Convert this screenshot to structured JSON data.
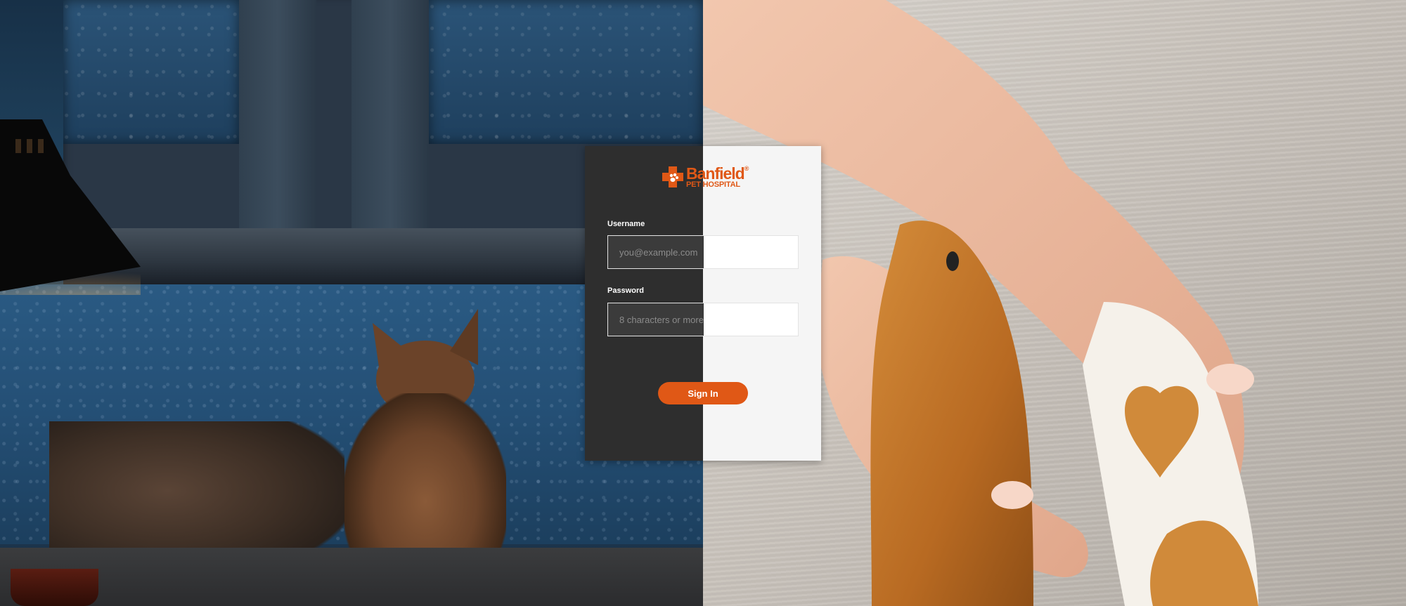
{
  "brand": {
    "name": "Banfield",
    "subtitle": "PET HOSPITAL",
    "trademark": "®",
    "color": "#e05816"
  },
  "login": {
    "username_label": "Username",
    "username_placeholder": "you@example.com",
    "username_value": "",
    "password_label": "Password",
    "password_placeholder": "8 characters or more",
    "password_value": "",
    "signin_label": "Sign In"
  },
  "colors": {
    "card_dark": "#2e2e2e",
    "card_light": "#f5f5f5",
    "button": "#e05816"
  },
  "icons": {
    "logo": "banfield-cross-paw-icon"
  }
}
